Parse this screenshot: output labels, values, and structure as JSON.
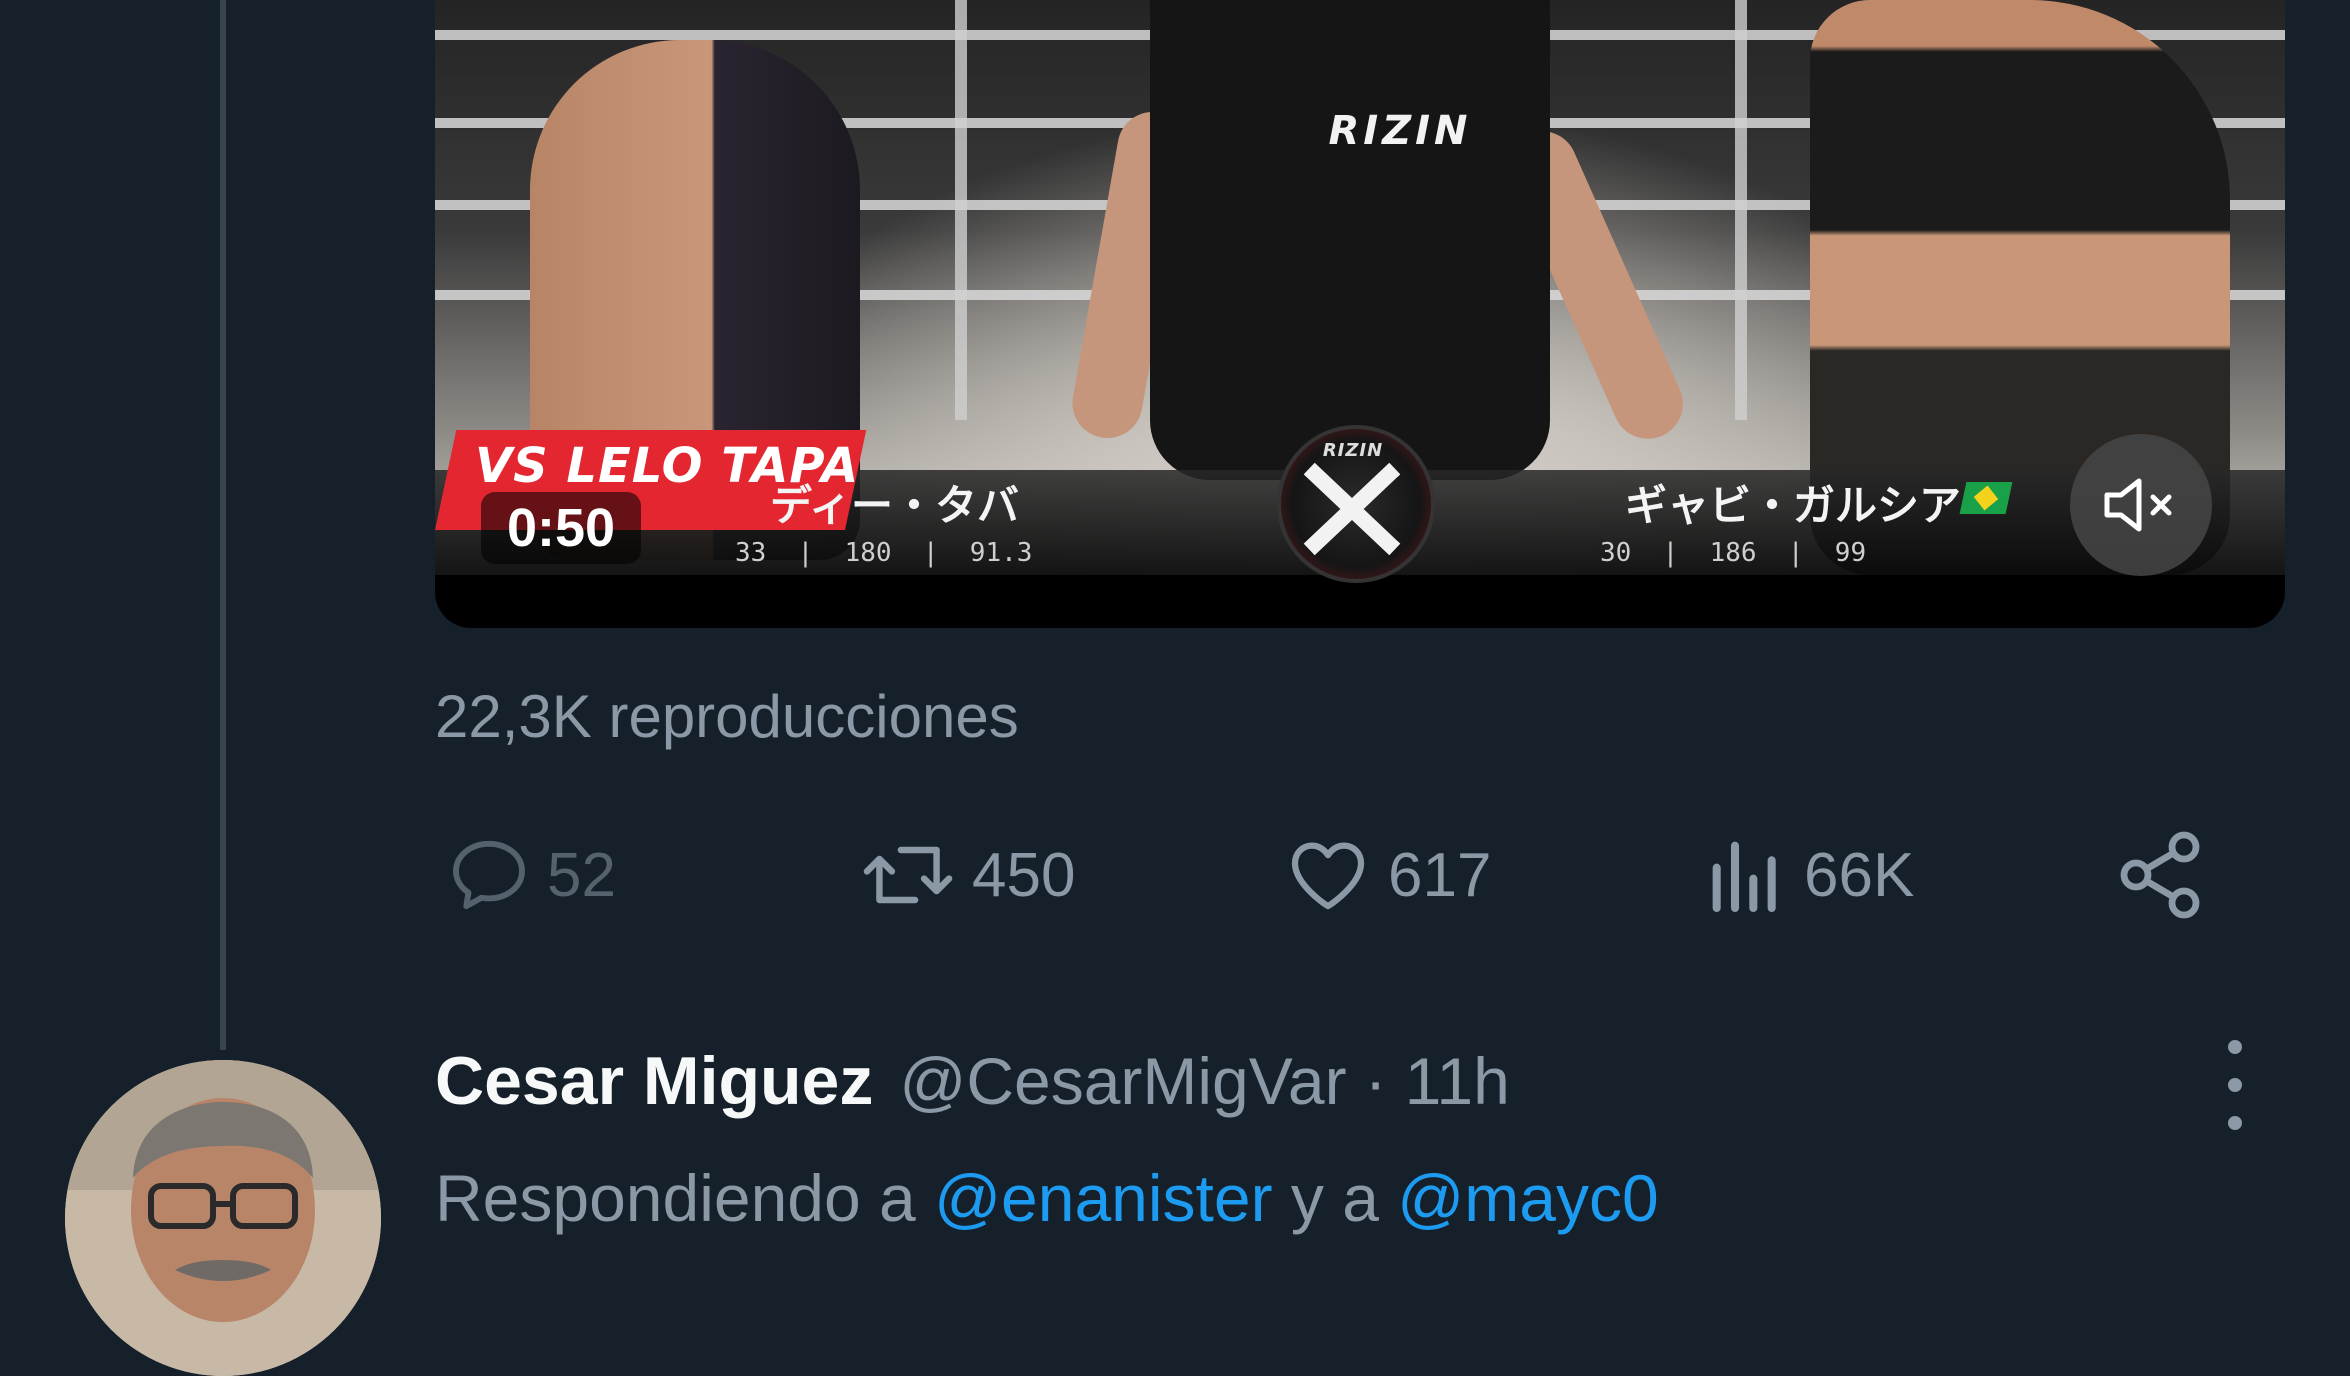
{
  "video": {
    "duration_remaining": "0:50",
    "promo_tag": "VS LELO TAPA",
    "fighter_left_name": "ディー・タバ",
    "fighter_right_name": "ギャビ・ガルシア",
    "fighter_left_stats": "33  |  180  |  91.3",
    "fighter_right_stats": "30  |  186  |  99",
    "brand_logo": "RIZIN",
    "vs_logo": "RIZIN",
    "mute_icon": "speaker-muted-icon"
  },
  "view_count": "22,3K reproducciones",
  "actions": {
    "replies": "52",
    "retweets": "450",
    "likes": "617",
    "views": "66K"
  },
  "reply_tweet": {
    "author_name": "Cesar Miguez",
    "author_handle": "@CesarMigVar",
    "separator": "·",
    "time": "11h",
    "replying_prefix": "Respondiendo a ",
    "mention_1": "@enanister",
    "joiner": " y a ",
    "mention_2": "@mayc0"
  },
  "colors": {
    "background": "#15202b",
    "muted_text": "#8b98a5",
    "accent": "#1d9bf0",
    "thread_line": "#38444d"
  }
}
